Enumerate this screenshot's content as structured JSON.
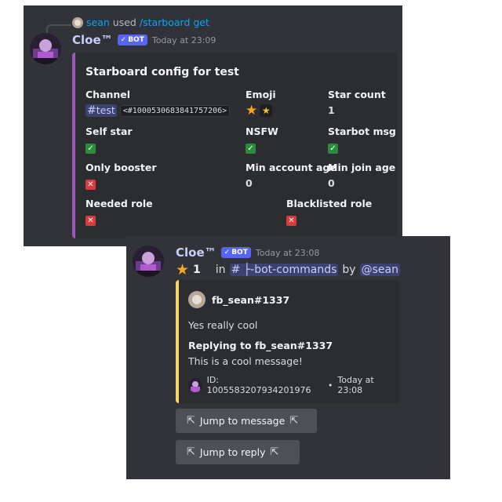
{
  "msg1": {
    "reply": {
      "user": "sean",
      "action": "used",
      "command": "/starboard get"
    },
    "author": "Cloe™",
    "bot_tag": "BOT",
    "timestamp": "Today at 23:09",
    "embed": {
      "title": "Starboard config for test",
      "fields": {
        "channel_name": "Channel",
        "channel_value": "test",
        "channel_id": "<#1000530683841757206>",
        "emoji_name": "Emoji",
        "star_count_name": "Star count",
        "star_count_value": "1",
        "self_star_name": "Self star",
        "nsfw_name": "NSFW",
        "starbot_msg_name": "Starbot msg",
        "only_booster_name": "Only booster",
        "min_account_age_name": "Min account age",
        "min_account_age_value": "0",
        "min_join_age_name": "Min join age",
        "min_join_age_value": "0",
        "needed_role_name": "Needed role",
        "blacklisted_role_name": "Blacklisted role"
      },
      "accent_color": "#9b59b6"
    }
  },
  "msg2": {
    "author": "Cloe™",
    "bot_tag": "BOT",
    "timestamp": "Today at 23:08",
    "star_count": "1",
    "in_word": "in",
    "channel": "├-bot-commands",
    "by_word": "by",
    "user_mention": "@sean",
    "embed": {
      "author": "fb_sean#1337",
      "content": "Yes really cool",
      "reply_heading": "Replying to fb_sean#1337",
      "reply_content": "This is a cool message!",
      "footer_id": "ID: 1005583207934201976",
      "footer_sep": "•",
      "footer_time": "Today at 23:08",
      "accent_color": "#f5d664"
    },
    "buttons": {
      "jump_message": "Jump to message",
      "jump_reply": "Jump to reply"
    }
  }
}
